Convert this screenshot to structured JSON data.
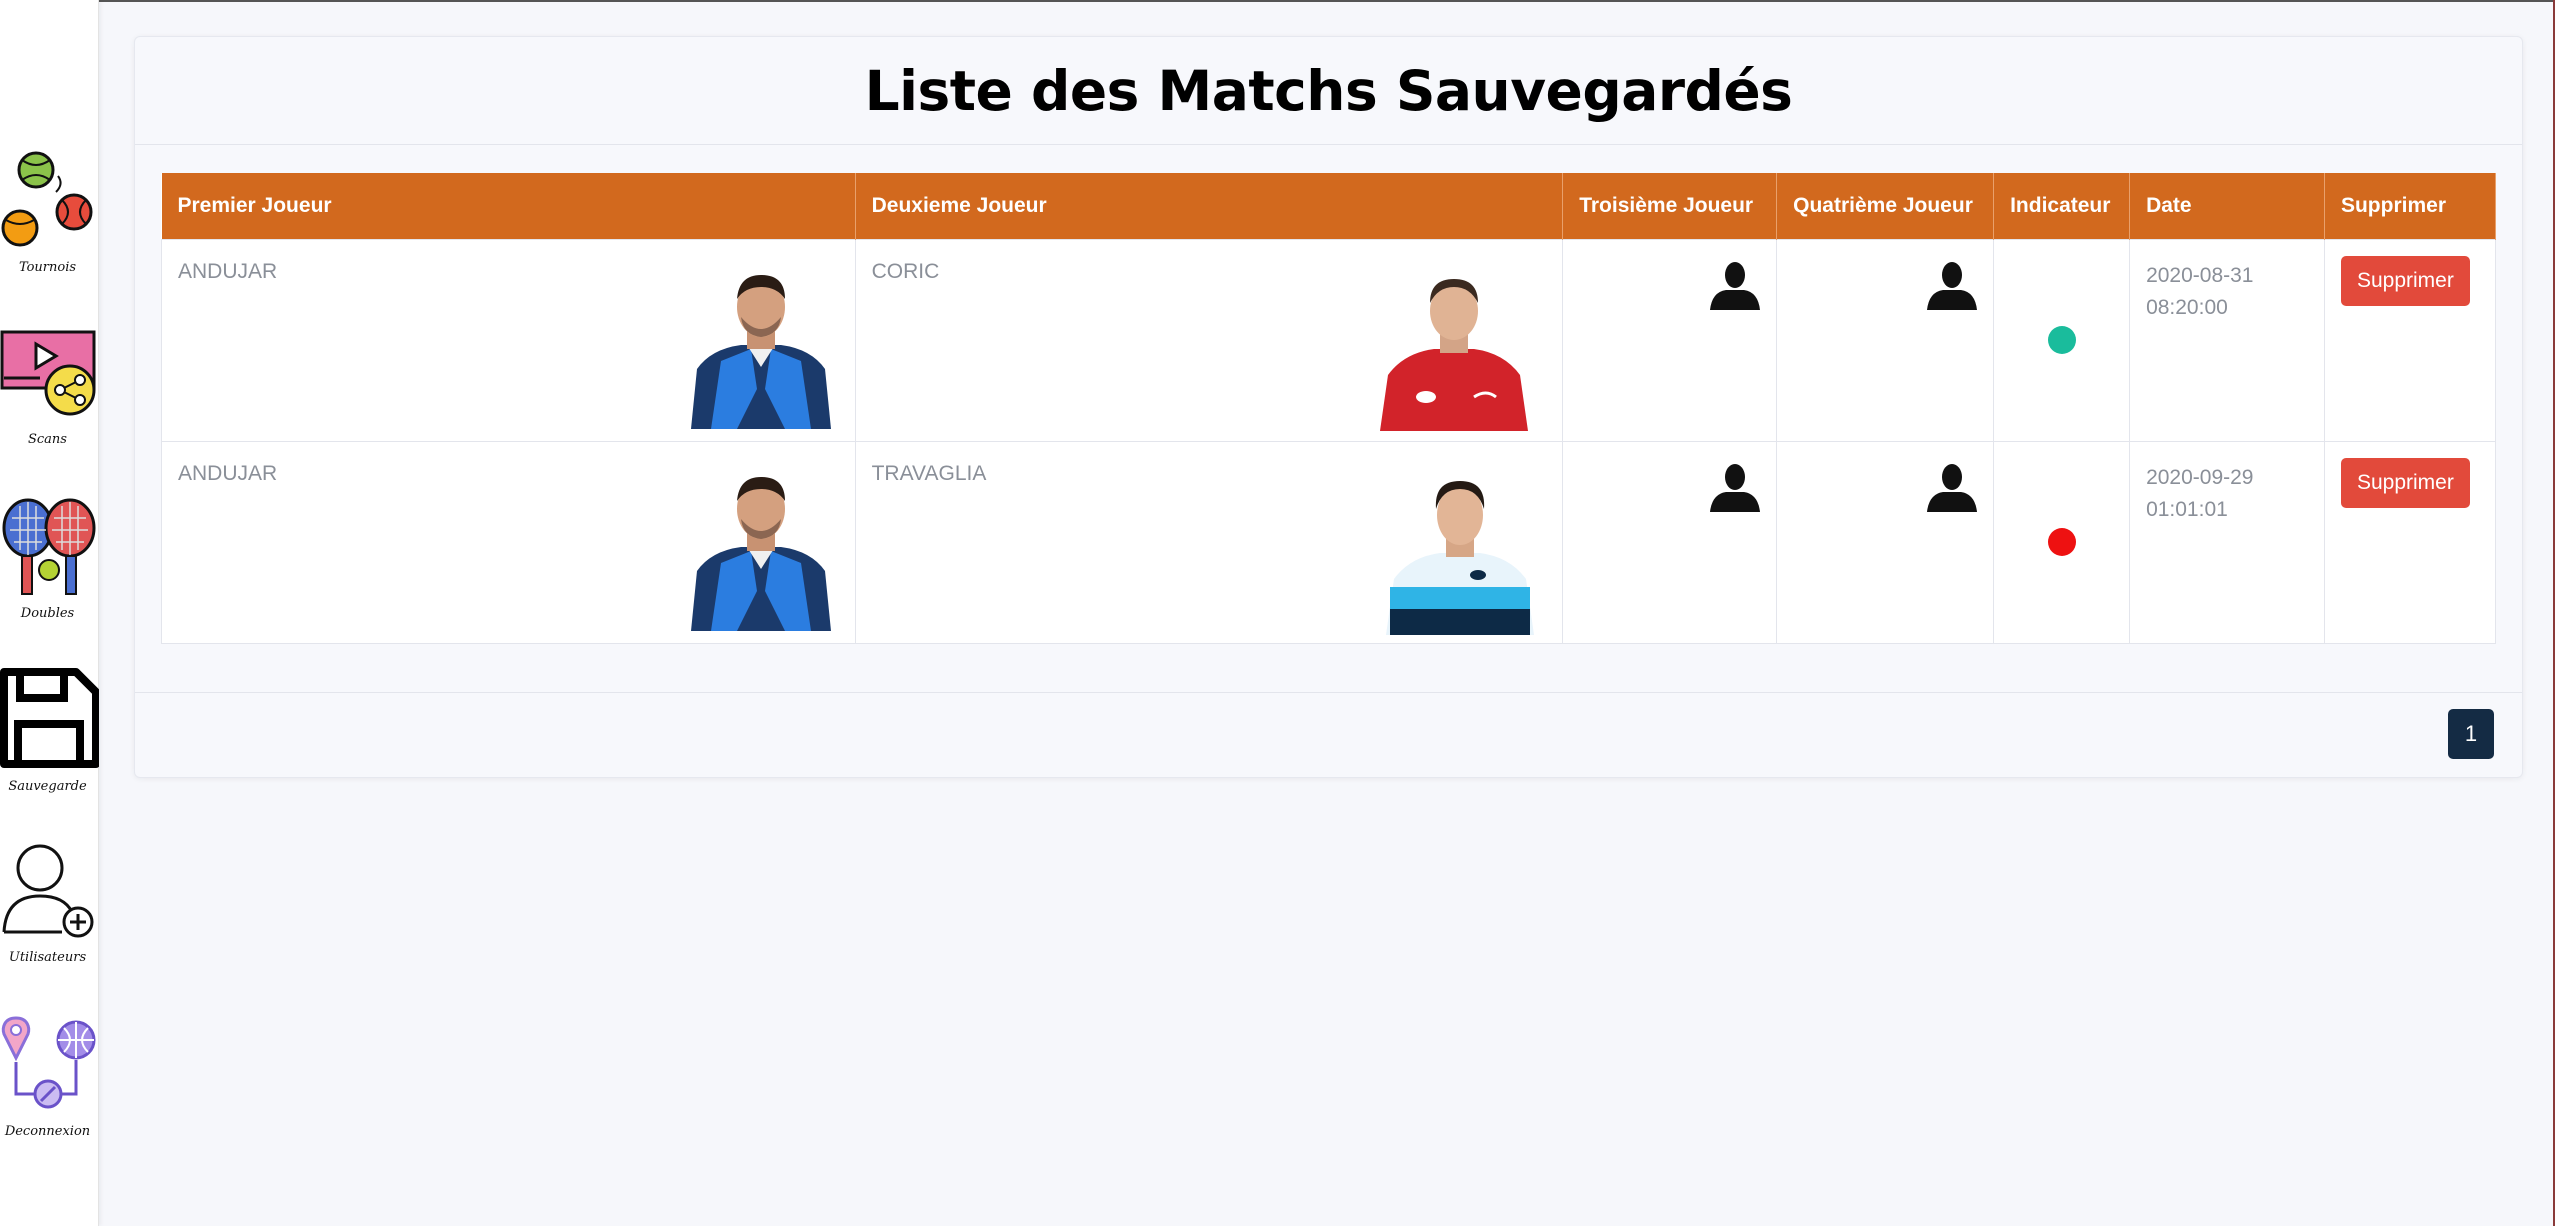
{
  "sidebar": {
    "items": [
      {
        "label": "Tournois",
        "icon": "tennis-balls-icon"
      },
      {
        "label": "Scans",
        "icon": "video-share-icon"
      },
      {
        "label": "Doubles",
        "icon": "tennis-rackets-icon"
      },
      {
        "label": "Sauvegarde",
        "icon": "floppy-disk-icon"
      },
      {
        "label": "Utilisateurs",
        "icon": "add-user-icon"
      },
      {
        "label": "Deconnexion",
        "icon": "location-network-icon"
      }
    ]
  },
  "page": {
    "title": "Liste des Matchs Sauvegardés"
  },
  "table": {
    "headers": [
      "Premier Joueur",
      "Deuxieme Joueur",
      "Troisième Joueur",
      "Quatrième Joueur",
      "Indicateur",
      "Date",
      "Supprimer"
    ],
    "rows": [
      {
        "player1": "ANDUJAR",
        "player2": "CORIC",
        "indicator_color": "#1abc9c",
        "date_line1": "2020-08-31",
        "date_line2": "08:20:00",
        "delete_label": "Supprimer"
      },
      {
        "player1": "ANDUJAR",
        "player2": "TRAVAGLIA",
        "indicator_color": "#ee1111",
        "date_line1": "2020-09-29",
        "date_line2": "01:01:01",
        "delete_label": "Supprimer"
      }
    ]
  },
  "pagination": {
    "current_page": "1"
  },
  "colors": {
    "header_bg": "#d2691e",
    "delete_button": "#e24a3b",
    "page_button": "#142b44"
  }
}
